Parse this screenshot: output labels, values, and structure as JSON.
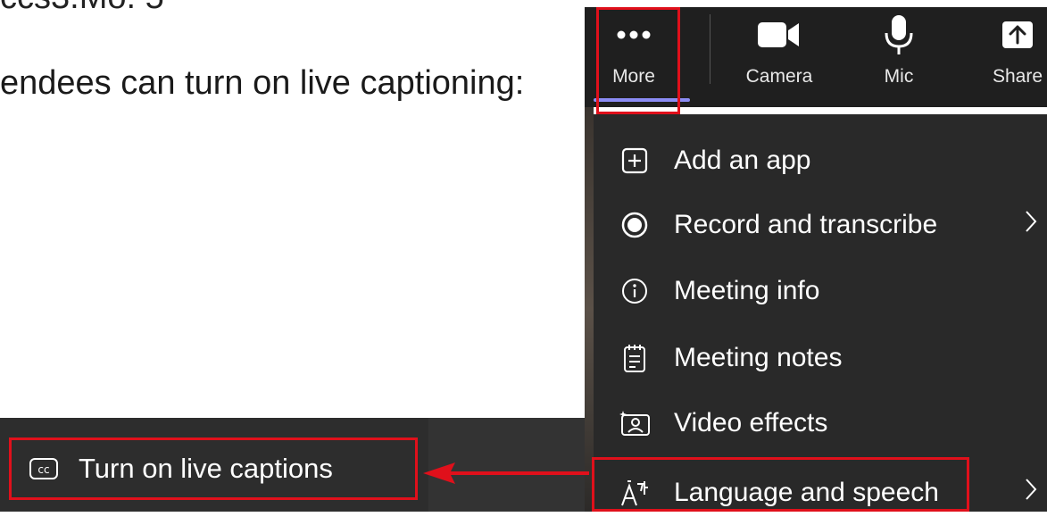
{
  "document": {
    "heading_fragment": "ccs3.Mo. 5",
    "sentence": "endees can turn on live captioning:"
  },
  "toolbar": {
    "buttons": [
      {
        "label": "More",
        "icon": "more-icon"
      },
      {
        "label": "Camera",
        "icon": "camera-icon"
      },
      {
        "label": "Mic",
        "icon": "mic-icon"
      },
      {
        "label": "Share",
        "icon": "share-icon"
      }
    ],
    "active": "More",
    "accent_color": "#8b8cf5"
  },
  "menu": {
    "items": [
      {
        "label": "Add an app",
        "icon": "add-app-icon",
        "has_submenu": false
      },
      {
        "label": "Record and transcribe",
        "icon": "record-icon",
        "has_submenu": true
      },
      {
        "label": "Meeting info",
        "icon": "info-icon",
        "has_submenu": false
      },
      {
        "label": "Meeting notes",
        "icon": "notes-icon",
        "has_submenu": false
      },
      {
        "label": "Video effects",
        "icon": "video-effects-icon",
        "has_submenu": false
      },
      {
        "label": "Language and speech",
        "icon": "language-icon",
        "has_submenu": true
      }
    ]
  },
  "captions": {
    "label": "Turn on live captions",
    "icon": "cc-icon"
  },
  "annotation": {
    "highlight_color": "#e0101b"
  }
}
